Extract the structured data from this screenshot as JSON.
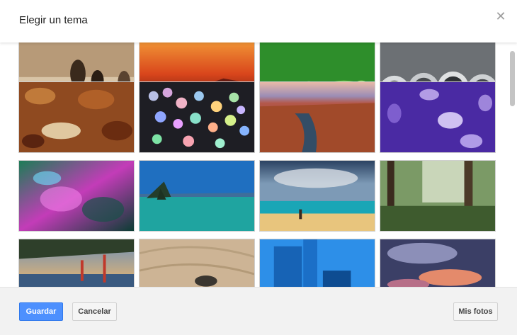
{
  "dialog": {
    "title": "Elegir un tema",
    "close_icon": "close-icon"
  },
  "footer": {
    "save_label": "Guardar",
    "cancel_label": "Cancelar",
    "my_photos_label": "Mis fotos"
  },
  "colors": {
    "primary_button": "#4d90fe",
    "header_bg": "#ffffff",
    "footer_bg": "#f2f2f2"
  },
  "themes": [
    {
      "name": "chess",
      "colors": [
        "#a68b6b",
        "#4a3b2b"
      ]
    },
    {
      "name": "red-canyon",
      "colors": [
        "#d84a18",
        "#6b140e"
      ]
    },
    {
      "name": "green-dew",
      "colors": [
        "#2e9a2f",
        "#6fcf40"
      ]
    },
    {
      "name": "metal-tubes",
      "colors": [
        "#d7d9da",
        "#585b5e"
      ]
    },
    {
      "name": "autumn-leaves",
      "colors": [
        "#a65e2b",
        "#5c2a10"
      ]
    },
    {
      "name": "bokeh",
      "colors": [
        "#222222",
        "#9c6ea3"
      ]
    },
    {
      "name": "canyon-river",
      "colors": [
        "#8c3e24",
        "#c26c40"
      ]
    },
    {
      "name": "jellyfish",
      "colors": [
        "#4b2aa8",
        "#9b7bd6"
      ]
    },
    {
      "name": "colorful-drops",
      "colors": [
        "#0b5b4d",
        "#d14fb6"
      ]
    },
    {
      "name": "lake-shore",
      "colors": [
        "#1d78c6",
        "#1fae9f"
      ]
    },
    {
      "name": "beach",
      "colors": [
        "#2b4a6e",
        "#e9c77d"
      ]
    },
    {
      "name": "forest",
      "colors": [
        "#2e4a26",
        "#7c9d5f"
      ]
    },
    {
      "name": "golden-gate",
      "colors": [
        "#e7a65a",
        "#395577"
      ]
    },
    {
      "name": "sand",
      "colors": [
        "#cdb59a",
        "#a98b6e"
      ]
    },
    {
      "name": "blue-buildings",
      "colors": [
        "#1773d2",
        "#3ea0ee"
      ]
    },
    {
      "name": "purple-clouds",
      "colors": [
        "#3a3c63",
        "#d26a5f"
      ]
    }
  ]
}
